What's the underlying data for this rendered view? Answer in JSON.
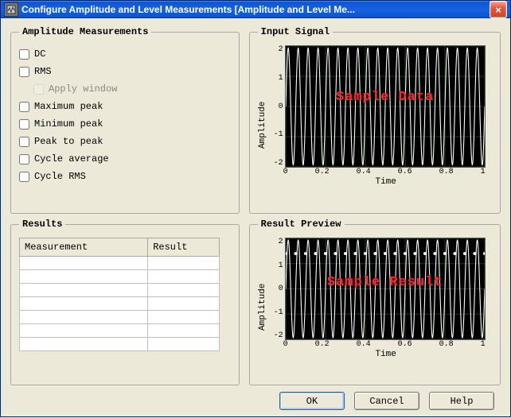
{
  "window": {
    "title": "Configure Amplitude and Level Measurements [Amplitude and Level Me..."
  },
  "groups": {
    "amplitude": "Amplitude Measurements",
    "input_signal": "Input Signal",
    "results": "Results",
    "result_preview": "Result Preview"
  },
  "amplitude_checks": {
    "dc": "DC",
    "rms": "RMS",
    "apply_window": "Apply window",
    "max_peak": "Maximum peak",
    "min_peak": "Minimum peak",
    "peak_to_peak": "Peak to peak",
    "cycle_average": "Cycle average",
    "cycle_rms": "Cycle RMS"
  },
  "results_table": {
    "columns": {
      "measurement": "Measurement",
      "result": "Result"
    },
    "empty_rows": 7
  },
  "buttons": {
    "ok": "OK",
    "cancel": "Cancel",
    "help": "Help"
  },
  "chart_data": [
    {
      "id": "input_signal",
      "type": "line",
      "title_overlay": "Sample Data",
      "xlabel": "Time",
      "ylabel": "Amplitude",
      "xlim": [
        0,
        1
      ],
      "ylim": [
        -2,
        2
      ],
      "x_ticks": [
        "0",
        "0.2",
        "0.4",
        "0.6",
        "0.8",
        "1"
      ],
      "y_ticks": [
        "2",
        "1",
        "0",
        "-1",
        "-2"
      ],
      "series": [
        {
          "name": "signal",
          "function": "sine",
          "frequency_hz": 20,
          "amplitude": 1.95,
          "offset": 0,
          "samples": 400
        }
      ],
      "markers": {
        "enabled": false
      },
      "grid": true
    },
    {
      "id": "result_preview",
      "type": "line",
      "title_overlay": "Sample Result",
      "xlabel": "Time",
      "ylabel": "Amplitude",
      "xlim": [
        0,
        1
      ],
      "ylim": [
        -2,
        2
      ],
      "x_ticks": [
        "0",
        "0.2",
        "0.4",
        "0.6",
        "0.8",
        "1"
      ],
      "y_ticks": [
        "2",
        "1",
        "0",
        "-1",
        "-2"
      ],
      "series": [
        {
          "name": "signal",
          "function": "sine",
          "frequency_hz": 20,
          "amplitude": 1.95,
          "offset": 0,
          "samples": 400
        },
        {
          "name": "dc_markers",
          "function": "constant",
          "value": 1.4,
          "marker_interval": 0.05
        }
      ],
      "markers": {
        "enabled": true,
        "y": 1.4,
        "count": 21
      },
      "grid": true
    }
  ]
}
